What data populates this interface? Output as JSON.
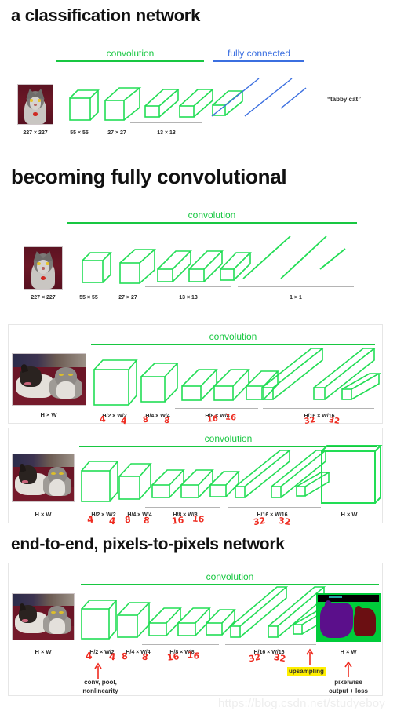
{
  "slides": [
    {
      "id": "classification",
      "title": "a classification network",
      "stages": [
        {
          "label": "convolution",
          "color": "#18c741"
        },
        {
          "label": "fully connected",
          "color": "#3b6fe0"
        }
      ],
      "dims": [
        "227 × 227",
        "55 × 55",
        "27 × 27",
        "13 × 13"
      ],
      "output_label": "“tabby cat”"
    },
    {
      "id": "becoming-fully-convolutional",
      "title": "becoming fully convolutional",
      "stages": [
        {
          "label": "convolution",
          "color": "#18c741"
        }
      ],
      "dims": [
        "227 × 227",
        "55 × 55",
        "27 × 27",
        "13 × 13",
        "1 × 1"
      ]
    },
    {
      "id": "fcn-dense-a",
      "title": "",
      "stages": [
        {
          "label": "convolution",
          "color": "#18c741"
        }
      ],
      "dims": [
        "H × W",
        "H/2 × W/2",
        "H/4 × W/4",
        "H/8 × W/8",
        "H/16 × W/16"
      ],
      "red_marks": [
        "4",
        "4",
        "8",
        "8",
        "16",
        "16",
        "32",
        "32"
      ]
    },
    {
      "id": "fcn-dense-b",
      "title": "",
      "stages": [
        {
          "label": "convolution",
          "color": "#18c741"
        }
      ],
      "dims": [
        "H × W",
        "H/2 × W/2",
        "H/4 × W/4",
        "H/8 × W/8",
        "H/16 × W/16",
        "H × W"
      ],
      "red_marks": [
        "4",
        "4",
        "8",
        "8",
        "16",
        "16",
        "32",
        "32"
      ]
    },
    {
      "id": "end-to-end",
      "title": "end-to-end, pixels-to-pixels network",
      "stages": [
        {
          "label": "convolution",
          "color": "#18c741"
        }
      ],
      "dims": [
        "H × W",
        "H/2 × W/2",
        "H/4 × W/4",
        "H/8 × W/8",
        "H/16 × W/16",
        "H × W"
      ],
      "red_marks": [
        "4",
        "4",
        "8",
        "8",
        "16",
        "16",
        "32",
        "32"
      ],
      "annotations": [
        {
          "text": "conv, pool,\nnonlinearity",
          "line1": "conv, pool,",
          "line2": "nonlinearity",
          "kind": "note"
        },
        {
          "text": "upsampling",
          "kind": "highlight",
          "highlight_color": "#ffef00"
        },
        {
          "text": "pixelwise\noutput + loss",
          "line1": "pixelwise",
          "line2": "output + loss",
          "kind": "note"
        }
      ]
    }
  ],
  "watermark": "https://blog.csdn.net/studyeboy",
  "colors": {
    "green": "#18c741",
    "box_green": "#22dd55",
    "blue": "#3b6fe0",
    "red_annotation": "#ee2b20",
    "grey_rule": "#b4b4b4",
    "highlight_yellow": "#ffef00",
    "title_black": "#111111"
  }
}
